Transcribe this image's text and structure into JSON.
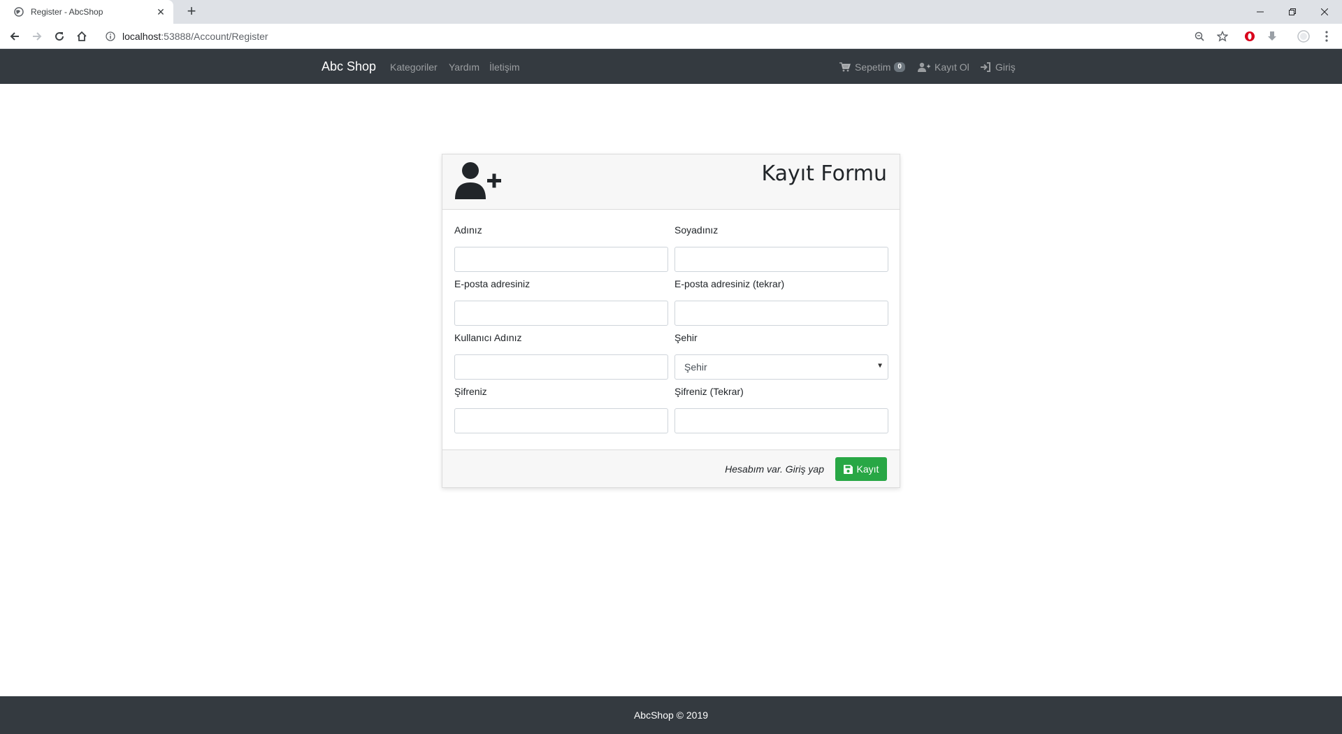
{
  "browser": {
    "tab_title": "Register - AbcShop",
    "url_host": "localhost",
    "url_path": ":53888/Account/Register"
  },
  "navbar": {
    "brand": "Abc Shop",
    "links": [
      "Kategoriler",
      "Yardım",
      "İletişim"
    ],
    "cart_label": "Sepetim",
    "cart_count": "0",
    "register_label": "Kayıt Ol",
    "login_label": "Giriş"
  },
  "form": {
    "title": "Kayıt Formu",
    "fields": {
      "first_name": "Adınız",
      "last_name": "Soyadınız",
      "email": "E-posta adresiniz",
      "email_repeat": "E-posta adresiniz (tekrar)",
      "username": "Kullanıcı Adınız",
      "city": "Şehir",
      "password": "Şifreniz",
      "password_repeat": "Şifreniz (Tekrar)"
    },
    "city_selected": "Şehir",
    "login_link": "Hesabım var. Giriş yap",
    "submit_label": "Kayıt"
  },
  "footer": {
    "text": "AbcShop © 2019"
  },
  "colors": {
    "navbar_bg": "#343a40",
    "success": "#28a745"
  }
}
